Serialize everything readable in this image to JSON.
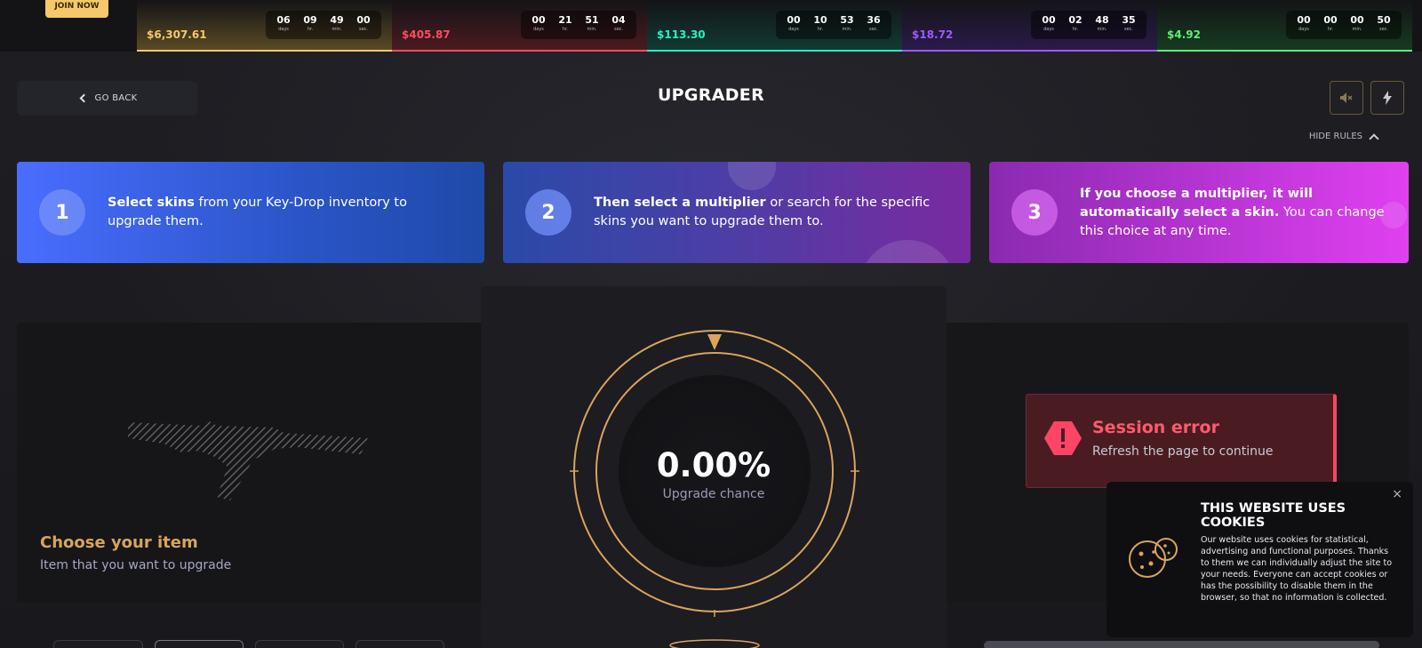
{
  "topstrip": {
    "join_label": "JOIN NOW",
    "cases": [
      {
        "price": "$6,307.61",
        "color": "#f5c86b",
        "bg": "#5a4a24",
        "days": "06",
        "hr": "09",
        "min": "49",
        "sec": "00"
      },
      {
        "price": "$405.87",
        "color": "#ff4c5f",
        "bg": "#4a1a20",
        "days": "00",
        "hr": "21",
        "min": "51",
        "sec": "04"
      },
      {
        "price": "$113.30",
        "color": "#27f0c0",
        "bg": "#123a33",
        "days": "00",
        "hr": "10",
        "min": "53",
        "sec": "36"
      },
      {
        "price": "$18.72",
        "color": "#9a5bff",
        "bg": "#2a1a4a",
        "days": "00",
        "hr": "02",
        "min": "48",
        "sec": "35"
      },
      {
        "price": "$4.92",
        "color": "#5cf07a",
        "bg": "#173a20",
        "days": "00",
        "hr": "00",
        "min": "00",
        "sec": "50"
      }
    ],
    "timer_labels": {
      "days": "days",
      "hr": "hr.",
      "min": "min.",
      "sec": "sec."
    }
  },
  "header": {
    "go_back": "GO BACK",
    "title": "UPGRADER",
    "hide_rules": "HIDE RULES",
    "icons": [
      "mute-icon",
      "lightning-icon"
    ]
  },
  "steps": [
    {
      "num": "1",
      "bold": "Select skins",
      "text": " from your Key-Drop inventory to upgrade them."
    },
    {
      "num": "2",
      "bold": "Then select a multiplier",
      "text": " or search for the specific skins you want to upgrade them to."
    },
    {
      "num": "3",
      "bold": "If you choose a multiplier, it will automatically select a skin.",
      "text": " You can change this choice at any time."
    }
  ],
  "left_panel": {
    "title": "Choose your item",
    "subtitle": "Item that you want to upgrade"
  },
  "center_panel": {
    "chance": "0.00%",
    "label": "Upgrade chance"
  },
  "session_error": {
    "title": "Session error",
    "subtitle": "Refresh the page to continue"
  },
  "cookie": {
    "title": "THIS WEBSITE USES COOKIES",
    "text": "Our website uses cookies for statistical, advertising and functional purposes. Thanks to them we can individually adjust the site to your needs. Everyone can accept cookies or has the possibility to disable them in the browser, so that no information is collected.",
    "close": "×"
  },
  "colors": {
    "accent_gold": "#d9a45b",
    "error_red": "#ff5a6e"
  }
}
